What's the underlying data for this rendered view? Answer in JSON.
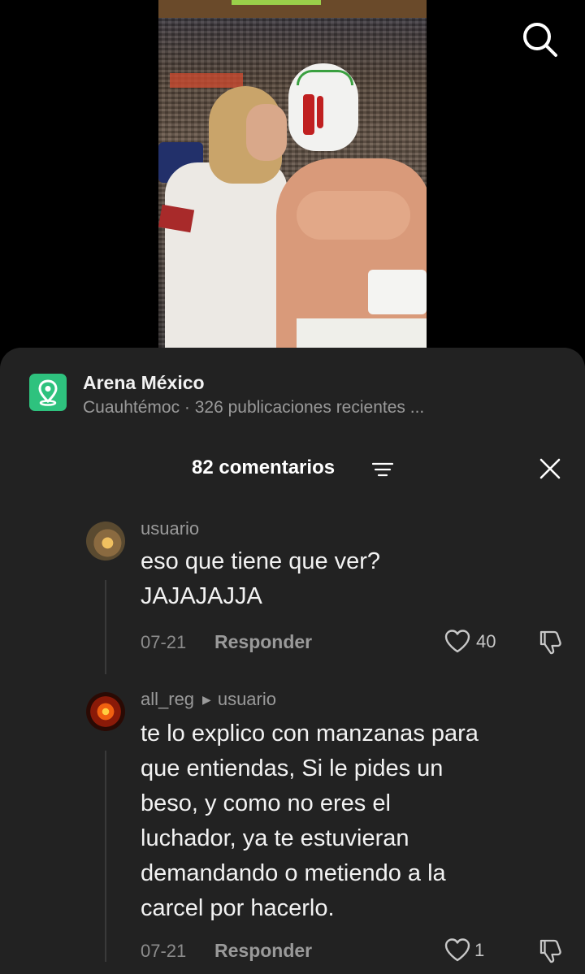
{
  "location": {
    "name": "Arena México",
    "subtitle": "Cuauhtémoc · 326 publicaciones recientes ..."
  },
  "comments_header": {
    "count_label": "82 comentarios"
  },
  "comments": [
    {
      "username": "usuario",
      "text_line1": "eso que tiene que ver?",
      "text_line2": "JAJAJAJJA",
      "date": "07-21",
      "reply_label": "Responder",
      "likes": "40"
    },
    {
      "username": "all_reg",
      "reply_to": "usuario",
      "lines": [
        "te lo explico con manzanas para",
        "que entiendas, Si le pides un",
        "beso, y como no eres el",
        "luchador, ya te estuvieran",
        "demandando o metiendo a la",
        "carcel por hacerlo."
      ],
      "date": "07-21",
      "reply_label": "Responder",
      "likes": "1"
    }
  ],
  "icons": {
    "search": "search-icon",
    "location": "location-pin-icon",
    "filter": "filter-icon",
    "close": "close-icon",
    "like": "heart-icon",
    "dislike": "thumbs-down-icon"
  },
  "colors": {
    "sheet_bg": "#222222",
    "location_green": "#2ec27e",
    "muted_text": "#9a9a9a"
  }
}
